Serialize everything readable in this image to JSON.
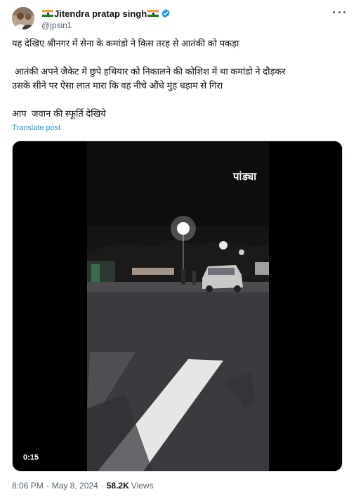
{
  "author": {
    "name": "Jitendra pratap singh",
    "handle": "@jpsin1"
  },
  "post": {
    "line1": "यह देखिए श्रीनगर में सेना के कमांडो ने किस तरह से आतंकी को पकड़ा",
    "line2": " आतंकी अपने जैकेट में छुपे हथियार को निकालने की कोशिश में था कमांडो ने दौड़कर",
    "line3": "उसके सीने पर ऐसा लात मारा कि वह नीचे औंधे मुंह धड़ाम से गिरा",
    "line4": "आप  जवान की स्फूर्ति देखिये",
    "translate_label": "Translate post"
  },
  "video": {
    "watermark": "पांड्या",
    "duration": "0:15"
  },
  "footer": {
    "time": "8:06 PM",
    "separator": "·",
    "date": "May 8, 2024",
    "views_count": "58.2K",
    "views_label": "Views"
  },
  "icons": {
    "verified": "verified-badge-icon",
    "more": "more-options-icon",
    "flag": "india-flag-emoji"
  },
  "colors": {
    "link": "#1d9bf0",
    "secondary_text": "#536471",
    "verified": "#1d9bf0"
  }
}
